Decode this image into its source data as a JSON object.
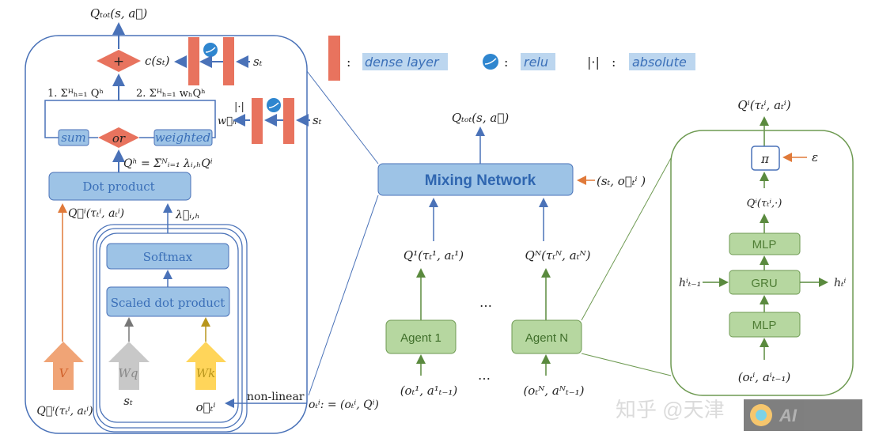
{
  "colors": {
    "blue_line": "#4a72b8",
    "blue_box": "#9dc3e6",
    "dense_red": "#e8735e",
    "green_line": "#6e9a52",
    "green_box": "#b6d7a0",
    "orange": "#f0a476",
    "gray": "#c8c8c8",
    "yellow": "#ffd55a"
  },
  "legend": {
    "dense_sep": ":",
    "dense_label": "dense layer",
    "relu_sep": ":",
    "relu_label": "relu",
    "abs_symbol": "|·|",
    "abs_sep": ":",
    "abs_label": "absolute"
  },
  "left": {
    "q_tot": "Qₜₒₜ(s, a⃗)",
    "plus": "+",
    "c_st": "c(sₜ)",
    "st_top": "sₜ",
    "sum1": "1. Σᴴₕ₌₁ Qʰ",
    "sum2": "2. Σᴴₕ₌₁ wₕQʰ",
    "sum_box": "sum",
    "or": "or",
    "weighted_box": "weighted",
    "abs": "|·|",
    "w_h": "w⃗ₕ",
    "st_mid": "sₜ",
    "qh_eq": "Qʰ = Σᴺᵢ₌₁ λᵢ,ₕQⁱ",
    "dot_product": "Dot product",
    "qi_vec": "Q⃗ⁱ(τₜⁱ, aₜⁱ)",
    "lambda": "λ⃗ᵢ,ₕ",
    "softmax": "Softmax",
    "scaled_dot": "Scaled dot product",
    "v": "V",
    "wq": "Wq",
    "wk": "Wk",
    "in_q": "Q⃗ⁱ(τₜⁱ, aₜⁱ)",
    "in_s": "sₜ",
    "in_o": "o⃗ₜⁱ",
    "nonlinear": "non-linear",
    "o_def": "oₜⁱ: = (oₜⁱ, Qⁱ)"
  },
  "middle": {
    "q_tot": "Qₜₒₜ(s, a⃗)",
    "mixing": "Mixing Network",
    "mix_input": "(sₜ, o⃗ₜⁱ )",
    "q1": "Q¹(τₜ¹, aₜ¹)",
    "qn": "Qᴺ(τₜᴺ, aₜᴺ)",
    "dots1": "…",
    "dots2": "…",
    "agent1": "Agent 1",
    "agentn": "Agent N",
    "in1": "(oₜ¹, a¹ₜ₋₁)",
    "inn": "(oₜᴺ, aᴺₜ₋₁)"
  },
  "right": {
    "qi_out": "Qⁱ(τₜⁱ, aₜⁱ)",
    "pi": "π",
    "epsilon": "ε",
    "qi_dot": "Qⁱ(τₜⁱ,·)",
    "mlp_top": "MLP",
    "gru": "GRU",
    "mlp_bottom": "MLP",
    "h_prev": "hⁱₜ₋₁",
    "h_next": "hₜⁱ",
    "input": "(oₜⁱ, aⁱₜ₋₁)"
  },
  "watermark": {
    "text": "知乎 @天津",
    "logo": "AI"
  }
}
